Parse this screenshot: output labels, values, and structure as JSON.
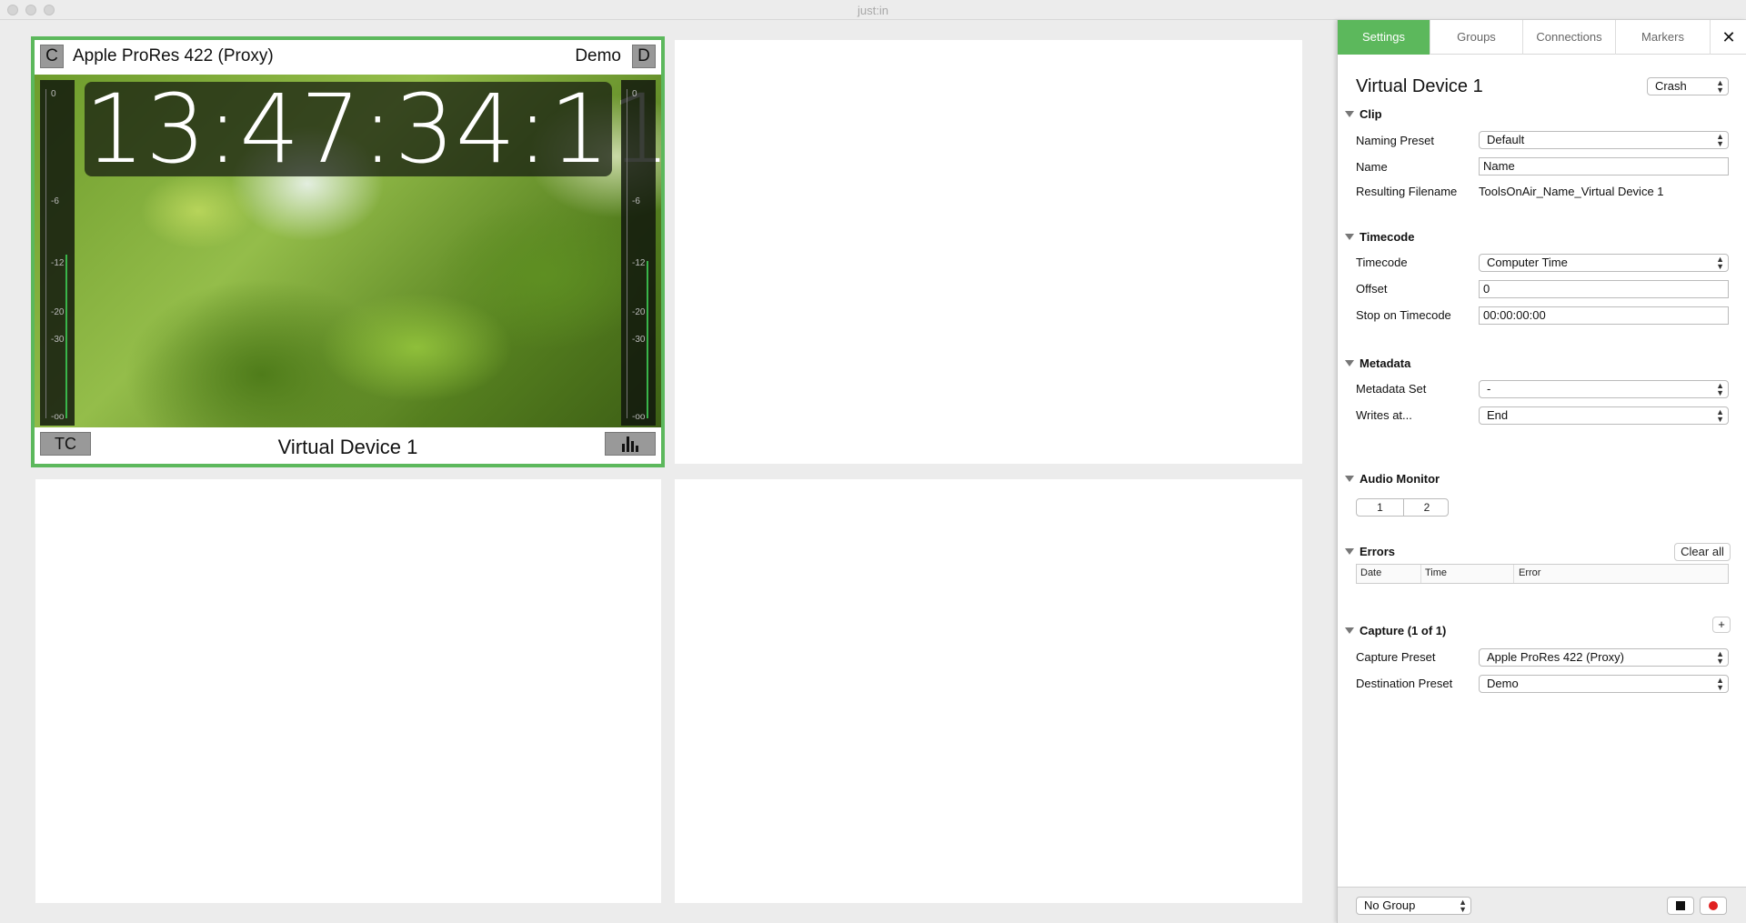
{
  "window": {
    "title": "just:in"
  },
  "device": {
    "left_badge": "C",
    "preset": "Apple ProRes 422 (Proxy)",
    "destination": "Demo",
    "right_badge": "D",
    "timecode": "13:47:34:11",
    "tc_button": "TC",
    "name": "Virtual Device 1",
    "border_color": "#5cb85c",
    "meter_scale": [
      "0",
      "-6",
      "-12",
      "-20",
      "-30",
      "-oo"
    ],
    "meter_levels": {
      "left": 0.5,
      "right": 0.48
    }
  },
  "tabs": [
    {
      "label": "Settings",
      "active": true
    },
    {
      "label": "Groups"
    },
    {
      "label": "Connections"
    },
    {
      "label": "Markers"
    }
  ],
  "panel": {
    "title": "Virtual Device 1",
    "mode": "Crash",
    "clip": {
      "heading": "Clip",
      "naming_preset_label": "Naming Preset",
      "naming_preset_value": "Default",
      "name_label": "Name",
      "name_value": "Name",
      "resulting_label": "Resulting Filename",
      "resulting_value": "ToolsOnAir_Name_Virtual Device 1"
    },
    "timecode": {
      "heading": "Timecode",
      "timecode_label": "Timecode",
      "timecode_value": "Computer Time",
      "offset_label": "Offset",
      "offset_value": "0",
      "stop_label": "Stop on Timecode",
      "stop_value": "00:00:00:00"
    },
    "metadata": {
      "heading": "Metadata",
      "set_label": "Metadata Set",
      "set_value": "-",
      "writes_label": "Writes at...",
      "writes_value": "End"
    },
    "audio": {
      "heading": "Audio Monitor",
      "channels": [
        "1",
        "2"
      ]
    },
    "errors": {
      "heading": "Errors",
      "clear_label": "Clear all",
      "columns": [
        "Date",
        "Time",
        "Error"
      ]
    },
    "capture": {
      "heading": "Capture (1 of 1)",
      "add_label": "+",
      "capture_label": "Capture Preset",
      "capture_value": "Apple ProRes 422 (Proxy)",
      "dest_label": "Destination Preset",
      "dest_value": "Demo"
    },
    "footer": {
      "group_value": "No Group"
    }
  },
  "accent_color": "#5cb85c",
  "record_color": "#e02020"
}
